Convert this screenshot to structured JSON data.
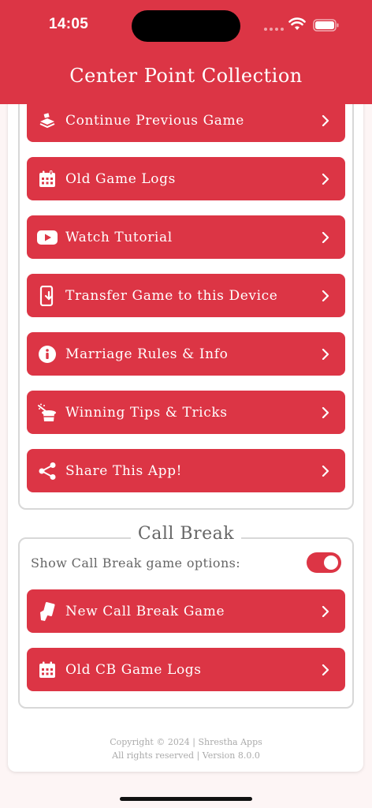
{
  "status": {
    "time": "14:05"
  },
  "header": {
    "title": "Center Point Collection"
  },
  "menu": [
    {
      "label": "Continue Previous Game",
      "icon": "layers-icon"
    },
    {
      "label": "Old Game Logs",
      "icon": "calendar-icon"
    },
    {
      "label": "Watch Tutorial",
      "icon": "youtube-icon"
    },
    {
      "label": "Transfer Game to this Device",
      "icon": "phone-download-icon"
    },
    {
      "label": "Marriage Rules & Info",
      "icon": "info-icon"
    },
    {
      "label": "Winning Tips & Tricks",
      "icon": "magic-hat-icon"
    },
    {
      "label": "Share This App!",
      "icon": "share-icon"
    }
  ],
  "callbreak": {
    "title": "Call Break",
    "toggle_label": "Show Call Break game options:",
    "toggle_on": true,
    "buttons": [
      {
        "label": "New Call Break Game",
        "icon": "cards-icon"
      },
      {
        "label": "Old CB Game Logs",
        "icon": "calendar-icon"
      }
    ]
  },
  "footer": {
    "line1": "Copyright © 2024 | Shrestha Apps",
    "line2": "All rights reserved | Version 8.0.0"
  },
  "colors": {
    "accent": "#dc3545",
    "background": "#fdf5f5"
  }
}
